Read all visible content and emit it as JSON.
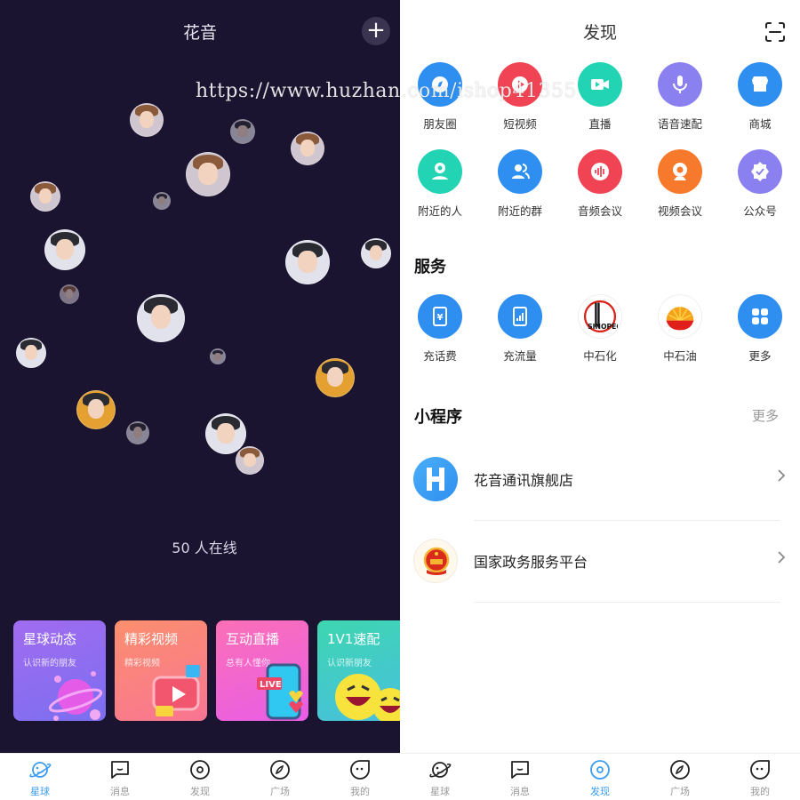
{
  "left": {
    "title": "花音",
    "online_text": "50 人在线",
    "cards": [
      {
        "title": "星球动态",
        "subtitle": "认识新的朋友"
      },
      {
        "title": "精彩视频",
        "subtitle": "精彩视频"
      },
      {
        "title": "互动直播",
        "subtitle": "总有人懂你"
      },
      {
        "title": "1V1速配",
        "subtitle": "认识新朋友"
      }
    ],
    "live_badge": "LIVE",
    "active_tab": 0
  },
  "right": {
    "title": "发现",
    "features": [
      {
        "label": "朋友圈",
        "icon": "compass-icon",
        "color": "#2e8ff0"
      },
      {
        "label": "短视频",
        "icon": "play-icon",
        "color": "#f04454"
      },
      {
        "label": "直播",
        "icon": "video-camera-icon",
        "color": "#22d3b4"
      },
      {
        "label": "语音速配",
        "icon": "microphone-icon",
        "color": "#8b80f0"
      },
      {
        "label": "商城",
        "icon": "store-icon",
        "color": "#2e8ff0"
      },
      {
        "label": "附近的人",
        "icon": "location-person-icon",
        "color": "#22d3b4"
      },
      {
        "label": "附近的群",
        "icon": "group-icon",
        "color": "#2e8ff0"
      },
      {
        "label": "音频会议",
        "icon": "audio-wave-icon",
        "color": "#f04454"
      },
      {
        "label": "视频会议",
        "icon": "webcam-icon",
        "color": "#f7792b"
      },
      {
        "label": "公众号",
        "icon": "verified-badge-icon",
        "color": "#8b80f0"
      }
    ],
    "services_title": "服务",
    "services": [
      {
        "label": "充话费",
        "icon": "phone-bill-icon",
        "color": "#2e8ff0"
      },
      {
        "label": "充流量",
        "icon": "data-traffic-icon",
        "color": "#2e8ff0"
      },
      {
        "label": "中石化",
        "icon": "sinopec-logo-icon",
        "color": "#ffffff"
      },
      {
        "label": "中石油",
        "icon": "petrochina-logo-icon",
        "color": "#ffffff"
      },
      {
        "label": "更多",
        "icon": "grid-more-icon",
        "color": "#2e8ff0"
      }
    ],
    "sinopec_text": "SINOPEC",
    "mini_title": "小程序",
    "mini_more": "更多",
    "mini_programs": [
      {
        "name": "花音通讯旗舰店",
        "icon": "huayin-logo-icon"
      },
      {
        "name": "国家政务服务平台",
        "icon": "national-emblem-icon"
      }
    ],
    "active_tab": 2
  },
  "tabs": [
    {
      "label": "星球",
      "icon": "planet-icon"
    },
    {
      "label": "消息",
      "icon": "message-icon"
    },
    {
      "label": "发现",
      "icon": "discover-icon"
    },
    {
      "label": "广场",
      "icon": "square-compass-icon"
    },
    {
      "label": "我的",
      "icon": "profile-face-icon"
    }
  ],
  "watermark": "https://www.huzhan.com/ishop41355",
  "colors": {
    "accent": "#3b9cf0",
    "dark_bg": "#1b1430"
  }
}
